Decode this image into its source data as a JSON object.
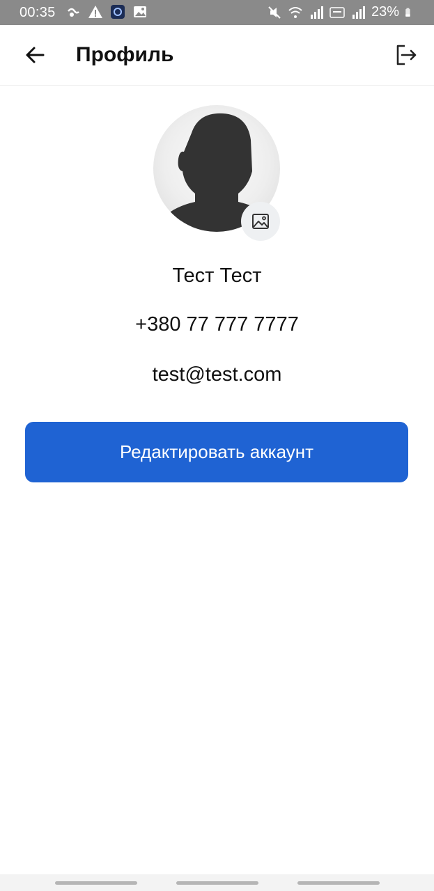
{
  "status_bar": {
    "time": "00:35",
    "battery": "23%",
    "left_icons": [
      "wind-icon",
      "warning-icon",
      "app-icon",
      "image-icon"
    ],
    "right_icons": [
      "mute-icon",
      "wifi-icon",
      "signal-icon",
      "volte-icon",
      "signal-icon",
      "battery-icon"
    ]
  },
  "app_bar": {
    "title": "Профиль",
    "back_icon": "arrow-left-icon",
    "logout_icon": "logout-icon"
  },
  "profile": {
    "name": "Тест Тест",
    "phone": "+380 77 777 7777",
    "email": "test@test.com",
    "avatar_icon": "person-silhouette-icon",
    "change_photo_icon": "image-icon"
  },
  "actions": {
    "edit_account_label": "Редактировать аккаунт"
  },
  "colors": {
    "accent": "#1f63d3",
    "status_bar": "#8a8a8a"
  }
}
